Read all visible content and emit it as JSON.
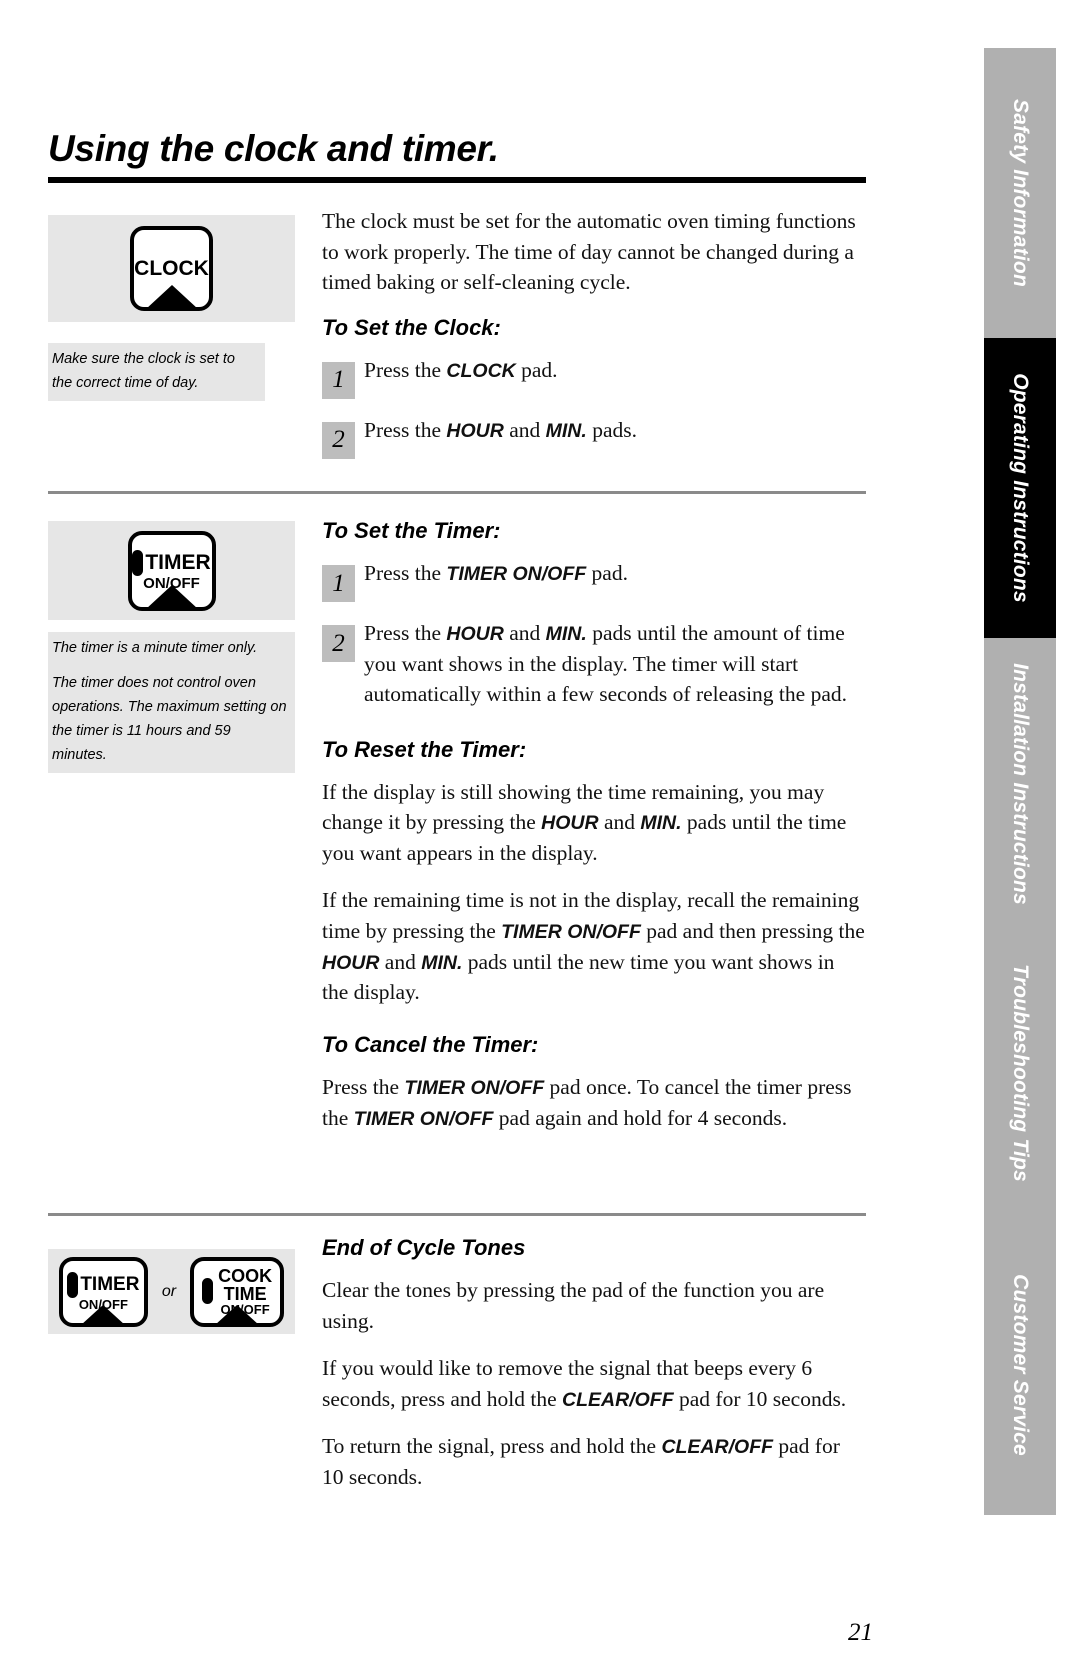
{
  "page": {
    "title": "Using the clock and timer.",
    "number": "21"
  },
  "tabs": [
    {
      "label": "Safety Information",
      "active": false
    },
    {
      "label": "Operating Instructions",
      "active": true
    },
    {
      "label": "Installation Instructions",
      "active": false
    },
    {
      "label": "Troubleshooting Tips",
      "active": false
    },
    {
      "label": "Customer Service",
      "active": false
    }
  ],
  "clock_section": {
    "pad": {
      "label": "CLOCK"
    },
    "note": "Make sure the clock is set to the correct time of day.",
    "intro": "The clock must be set for the automatic oven timing functions to work properly. The time of day cannot be changed during a timed baking or self-cleaning cycle.",
    "heading": "To Set the Clock:",
    "steps": [
      {
        "number": "1",
        "text_before": "Press the ",
        "emphasis": "CLOCK",
        "text_after": " pad."
      },
      {
        "number": "2",
        "text_before": "Press the ",
        "emphasis": "HOUR",
        "middle": " and ",
        "emphasis2": "MIN.",
        "text_after": " pads."
      }
    ]
  },
  "timer_section": {
    "pad": {
      "label": "TIMER",
      "sublabel": "ON/OFF"
    },
    "notes": [
      "The timer is a minute timer only.",
      "The timer does not control oven operations. The maximum setting on the timer is 11 hours and 59 minutes."
    ],
    "set_heading": "To Set the Timer:",
    "set_steps": [
      {
        "number": "1",
        "text_before": "Press the ",
        "emphasis": "TIMER ON/OFF",
        "text_after": " pad."
      },
      {
        "number": "2",
        "text_before": "Press the ",
        "emphasis": "HOUR",
        "middle": " and ",
        "emphasis2": "MIN.",
        "text_after": " pads until the amount of time you want shows in the display. The timer will start automatically within a few seconds of releasing the pad."
      }
    ],
    "reset_heading": "To Reset the Timer:",
    "reset_p1_a": "If the display is still showing the time remaining, you may change it by pressing the ",
    "reset_p1_em1": "HOUR",
    "reset_p1_b": " and ",
    "reset_p1_em2": "MIN.",
    "reset_p1_c": " pads until the time you want appears in the display.",
    "reset_p2_a": "If the remaining time is not in the display, recall the remaining time by pressing the ",
    "reset_p2_em1": "TIMER ON/OFF",
    "reset_p2_b": " pad and then pressing the ",
    "reset_p2_em2": "HOUR",
    "reset_p2_c": " and ",
    "reset_p2_em3": "MIN.",
    "reset_p2_d": " pads until the new time you want shows in the display.",
    "cancel_heading": "To Cancel the Timer:",
    "cancel_a": "Press the ",
    "cancel_em1": "TIMER ON/OFF",
    "cancel_b": " pad once. To cancel the timer press the ",
    "cancel_em2": "TIMER ON/OFF",
    "cancel_c": " pad again and hold for 4 seconds."
  },
  "tones_section": {
    "pad_timer": {
      "label": "TIMER",
      "sublabel": "ON/OFF"
    },
    "or_label": "or",
    "pad_cook": {
      "label_line1": "COOK",
      "label_line2": "TIME",
      "sublabel": "ON/OFF"
    },
    "heading": "End of Cycle Tones",
    "p1": "Clear the tones by pressing the pad of the function you are using.",
    "p2_a": "If you would like to remove the signal that beeps every 6 seconds, press and hold the ",
    "p2_em": "CLEAR/OFF",
    "p2_b": " pad for 10 seconds.",
    "p3_a": "To return the signal, press and hold the ",
    "p3_em": "CLEAR/OFF",
    "p3_b": " pad for 10 seconds."
  }
}
